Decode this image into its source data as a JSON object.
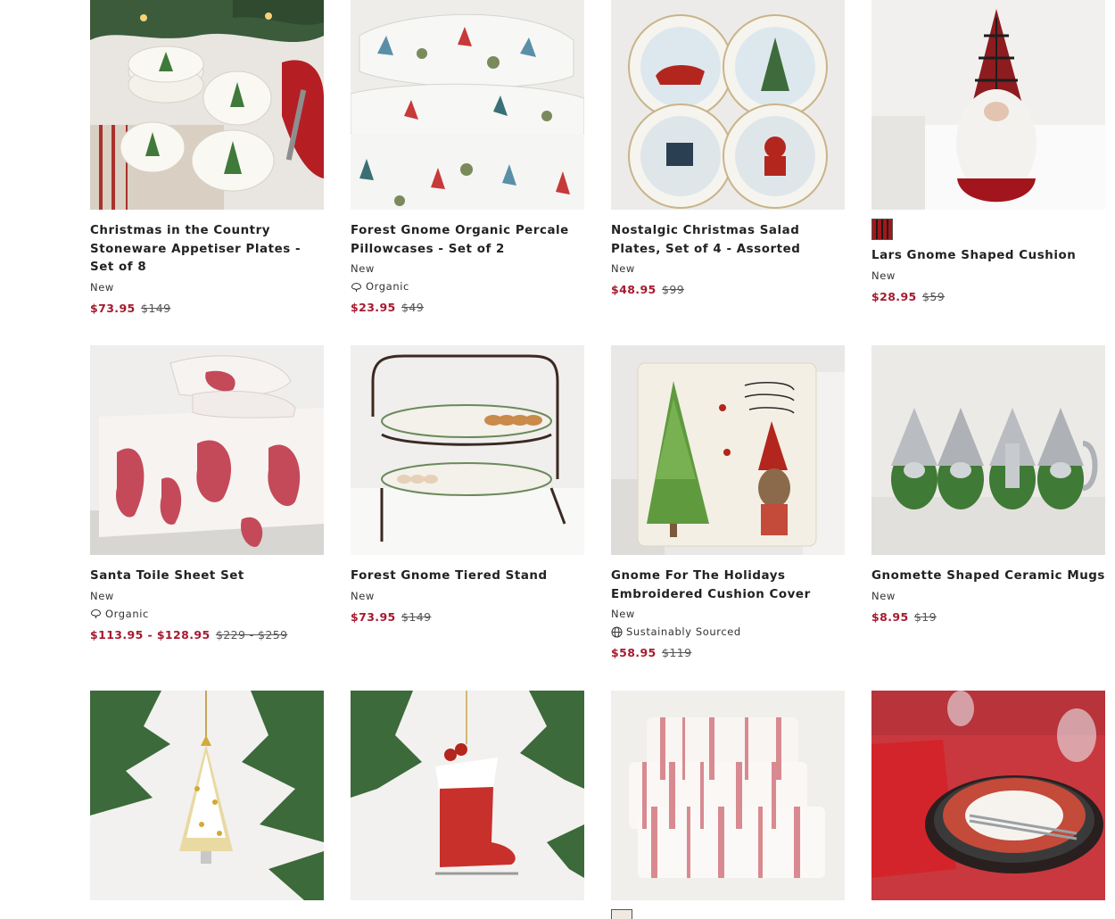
{
  "products": [
    {
      "title": "Christmas in the Country Stoneware Appetiser Plates - Set of 8",
      "flag": "New",
      "attribute": "",
      "sale_price": "$73.95",
      "orig_price": "$149"
    },
    {
      "title": "Forest Gnome Organic Percale Pillowcases - Set of 2",
      "flag": "New",
      "attribute": "Organic",
      "sale_price": "$23.95",
      "orig_price": "$49"
    },
    {
      "title": "Nostalgic Christmas Salad Plates, Set of 4 - Assorted",
      "flag": "New",
      "attribute": "",
      "sale_price": "$48.95",
      "orig_price": "$99"
    },
    {
      "title": "Lars Gnome Shaped Cushion",
      "flag": "New",
      "attribute": "",
      "sale_price": "$28.95",
      "orig_price": "$59",
      "swatch_colors": [
        "#a4161a"
      ]
    },
    {
      "title": "Santa Toile Sheet Set",
      "flag": "New",
      "attribute": "Organic",
      "sale_price": "$113.95 - $128.95",
      "orig_price": "$229 - $259"
    },
    {
      "title": "Forest Gnome Tiered Stand",
      "flag": "New",
      "attribute": "",
      "sale_price": "$73.95",
      "orig_price": "$149"
    },
    {
      "title": "Gnome For The Holidays Embroidered Cushion Cover",
      "flag": "New",
      "attribute": "Sustainably Sourced",
      "sale_price": "$58.95",
      "orig_price": "$119"
    },
    {
      "title": "Gnomette Shaped Ceramic Mugs",
      "flag": "New",
      "attribute": "",
      "sale_price": "$8.95",
      "orig_price": "$19"
    }
  ],
  "colors": {
    "sale": "#a6192e",
    "text": "#222222"
  }
}
